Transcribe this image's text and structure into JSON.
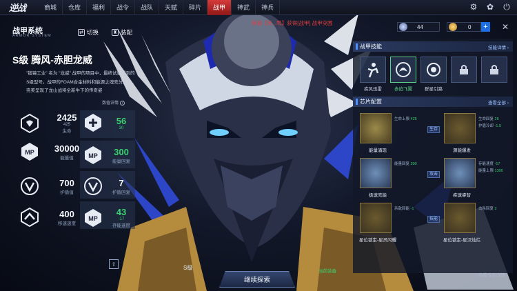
{
  "header": {
    "logo": "逆战",
    "nav": [
      "商城",
      "仓库",
      "福利",
      "战令",
      "战队",
      "天赋",
      "碎片",
      "战甲",
      "神武",
      "神兵"
    ],
    "active_nav": "战甲"
  },
  "banner": "恭喜【天...鸭】获得[战甲] 战甲突围",
  "left": {
    "title": "战甲系统",
    "subtitle": "ARMOR SYSTEM",
    "switch_label": "切换",
    "equip_label": "装配",
    "armor_name": "S级 腾风-赤胆龙威",
    "description": "\"锻镜工业\" 名为 \"龙威\" 战甲的项目中，最终试验得到的S级型号。战甲的FOAM合金材料和能源之魂充分融合，完美呈现了龙山战将全新牛下的传奇姿",
    "stats_header": "数值详情",
    "stats": [
      {
        "icon": "heart-shield-icon",
        "value": "2425",
        "sub": "425",
        "label": "生命",
        "side": "left"
      },
      {
        "icon": "plus-shield-icon",
        "value": "56",
        "sub": "30",
        "label": "",
        "side": "right",
        "green": true
      },
      {
        "icon": "mp-icon",
        "value": "30000",
        "sub": "",
        "label": "能量值",
        "side": "left"
      },
      {
        "icon": "mp-regen-icon",
        "value": "300",
        "sub": "300",
        "label": "能量回复",
        "side": "right",
        "green": true
      },
      {
        "icon": "shield-v-icon",
        "value": "700",
        "sub": "",
        "label": "护盾值",
        "side": "left"
      },
      {
        "icon": "shield-regen-icon",
        "value": "7",
        "sub": "",
        "label": "护盾回复",
        "side": "right"
      },
      {
        "icon": "speed-icon",
        "value": "400",
        "sub": "",
        "label": "移速速度",
        "side": "left"
      },
      {
        "icon": "mp-cost-icon",
        "value": "43",
        "sub": "-17",
        "label": "存能速度",
        "side": "right",
        "green": true
      }
    ]
  },
  "center": {
    "continue_label": "继续探索",
    "current_label": "当前装备",
    "s_label": "S级"
  },
  "right": {
    "currency": [
      {
        "icon": "crystal-icon",
        "value": "44"
      },
      {
        "icon": "gold-coin-icon",
        "value": "0"
      }
    ],
    "skills_title": "战甲技能",
    "skills_link": "技能详情",
    "skills": [
      {
        "name": "疾风迅雷",
        "icon": "dash-icon",
        "locked": false,
        "selected": false
      },
      {
        "name": "赤焰飞翼",
        "icon": "flame-wing-icon",
        "locked": false,
        "selected": true
      },
      {
        "name": "群星引路",
        "icon": "star-path-icon",
        "locked": false,
        "selected": false
      },
      {
        "name": "",
        "icon": "lock-icon",
        "locked": true,
        "selected": false
      },
      {
        "name": "",
        "icon": "lock-icon",
        "locked": true,
        "selected": false
      }
    ],
    "chips_title": "芯片配置",
    "chips_link": "查看全部",
    "chips": [
      {
        "name": "能量涌现",
        "attr1": "生命上限",
        "val1": "425",
        "attr2": "",
        "val2": "",
        "rel": "生存"
      },
      {
        "name": "源能爆发",
        "attr1": "生命回复",
        "val1": "26",
        "attr2": "护盾冷却",
        "val2": "-1.5",
        "rel": ""
      },
      {
        "name": "极速充能",
        "attr1": "能量回复",
        "val1": "300",
        "attr2": "",
        "val2": "",
        "rel": "攻击"
      },
      {
        "name": "疾速睿智",
        "attr1": "存能速度",
        "val1": "-17",
        "attr2": "能量上限",
        "val2": "1300",
        "rel": ""
      },
      {
        "name": "星位锁定-星灵闪耀",
        "attr1": "杀敌回能",
        "val1": "-1",
        "attr2": "",
        "val2": "",
        "rel": "技能"
      },
      {
        "name": "星位锁定-星汉灿烂",
        "attr1": "击杀回复",
        "val1": "2",
        "attr2": "",
        "val2": "",
        "rel": ""
      }
    ],
    "bottom_link": "隐藏全部详情"
  }
}
